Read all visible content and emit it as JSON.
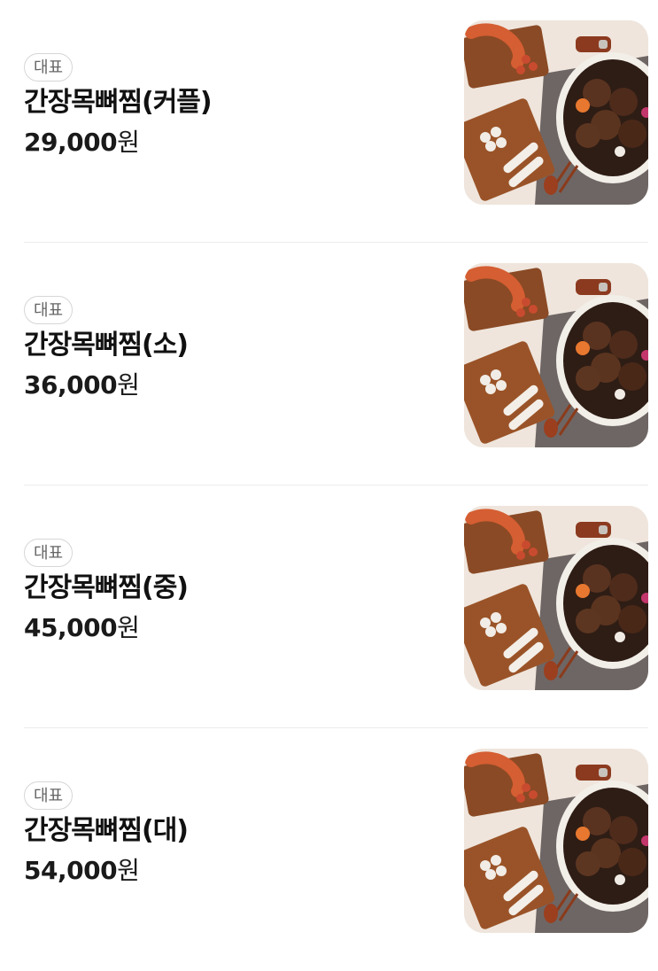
{
  "menu": {
    "items": [
      {
        "badge": "대표",
        "name": "간장목뼈찜(커플)",
        "price_amount": "29,000",
        "price_unit": "원",
        "image_icon": "braised-pork-neck-bone-photo"
      },
      {
        "badge": "대표",
        "name": "간장목뼈찜(소)",
        "price_amount": "36,000",
        "price_unit": "원",
        "image_icon": "braised-pork-neck-bone-photo"
      },
      {
        "badge": "대표",
        "name": "간장목뼈찜(중)",
        "price_amount": "45,000",
        "price_unit": "원",
        "image_icon": "braised-pork-neck-bone-photo"
      },
      {
        "badge": "대표",
        "name": "간장목뼈찜(대)",
        "price_amount": "54,000",
        "price_unit": "원",
        "image_icon": "braised-pork-neck-bone-photo"
      }
    ]
  },
  "colors": {
    "badge_border": "#d6d6d6",
    "badge_text": "#666666",
    "divider": "#ececec",
    "title_text": "#111111"
  }
}
